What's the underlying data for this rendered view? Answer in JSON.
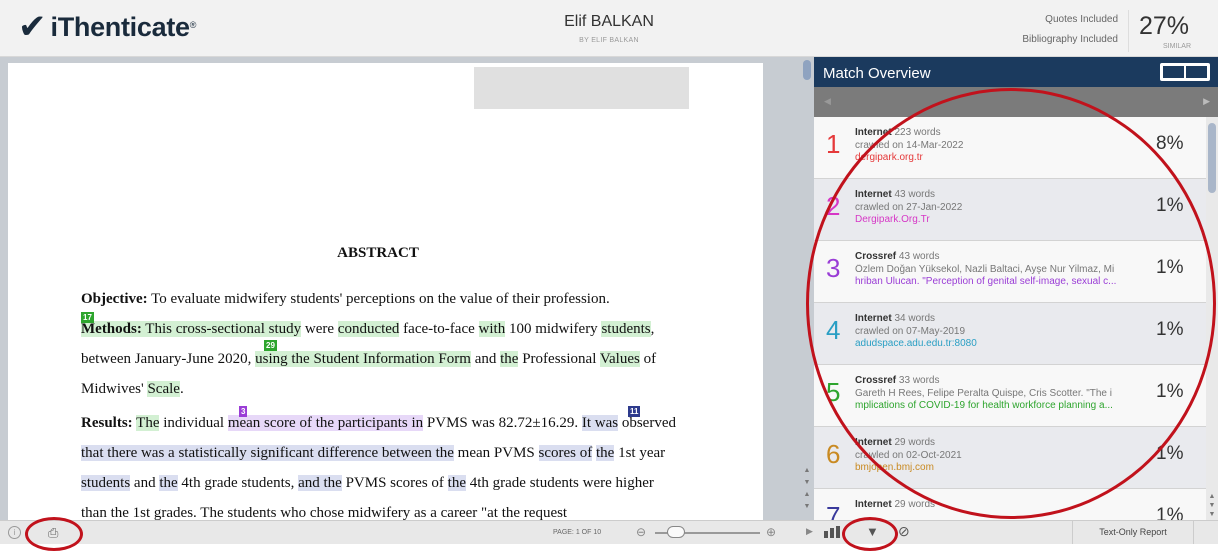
{
  "header": {
    "brand": "iThenticate",
    "check": "✔",
    "reg": "®",
    "doc_title": "Elif BALKAN",
    "doc_author": "BY ELIF BALKAN",
    "filter_quotes": "Quotes Included",
    "filter_bibliography": "Bibliography Included",
    "similarity": "27%",
    "similarity_label": "SIMILAR"
  },
  "document": {
    "heading": "ABSTRACT",
    "objective_label": "Objective:",
    "objective_text": " To evaluate midwifery students' perceptions on the value of their profession.",
    "tag17": "17",
    "tag29": "29",
    "tag3": "3",
    "tag11": "11",
    "m_label": "Methods:",
    "m1": " This cross-sectional study",
    "m2": " were ",
    "m3": "conducted",
    "m4": " face-to-face ",
    "m5": "with",
    "m6": " 100 midwifery ",
    "m7": "students",
    "m8": ", between January-June 2020, ",
    "m9": "using the Student Information Form",
    "m10": " and ",
    "m11": "the",
    "m12": " Professional ",
    "m13": "Values",
    "m14": " of Midwives' ",
    "m15": "Scale",
    "m16": ".",
    "r_label": "Results:",
    "r1": " ",
    "r2": "The",
    "r3": " individual ",
    "r4": "mean score of the participants in",
    "r5": " PVMS was 82.72±16.29. ",
    "r6": "It was",
    "r7": " observed ",
    "r8": "that there was a statistically significant difference between the",
    "r9": " mean PVMS ",
    "r10": "scores of",
    "r11": " ",
    "r12": "the",
    "r13": " 1st year ",
    "r14": "students",
    "r15": " and ",
    "r16": "the",
    "r17": " 4th grade students, ",
    "r18": "and the",
    "r19": " PVMS scores of ",
    "r20": "the",
    "r21": " 4th grade students were higher than the 1st grades. The students who chose midwifery as a career \"at the request"
  },
  "bottom_bar": {
    "info_icon": "i",
    "print_icon": "⎙",
    "page_label": "PAGE: 1 OF 10",
    "zoom_out": "⊖",
    "zoom_in": "⊕",
    "arrow": "▶",
    "filter_icon": "▼",
    "block_icon": "⊘",
    "text_only": "Text-Only Report"
  },
  "panel": {
    "title": "Match Overview",
    "left_arrow": "◀",
    "right_arrow": "▶",
    "matches": [
      {
        "num": "1",
        "type": "Internet",
        "words": "223 words",
        "crawled": "crawled on 14-Mar-2022",
        "link": "dergipark.org.tr",
        "pct": "8%",
        "color": "#e5393a"
      },
      {
        "num": "2",
        "type": "Internet",
        "words": "43 words",
        "crawled": "crawled on 27-Jan-2022",
        "link": "Dergipark.Org.Tr",
        "pct": "1%",
        "color": "#d637c6"
      },
      {
        "num": "3",
        "type": "Crossref",
        "words": "43 words",
        "crawled": "Özlem Doğan Yüksekol, Nazli Baltaci, Ayşe Nur Yilmaz, Mi",
        "link": "hriban Ulucan. \"Perception of genital self-image, sexual c...",
        "pct": "1%",
        "color": "#9a3dd6"
      },
      {
        "num": "4",
        "type": "Internet",
        "words": "34 words",
        "crawled": "crawled on 07-May-2019",
        "link": "adudspace.adu.edu.tr:8080",
        "pct": "1%",
        "color": "#2a9fc4"
      },
      {
        "num": "5",
        "type": "Crossref",
        "words": "33 words",
        "crawled": "Gareth H Rees, Felipe Peralta Quispe, Cris Scotter. \"The i",
        "link": "mplications of COVID-19 for health workforce planning a...",
        "pct": "1%",
        "color": "#2ea52e"
      },
      {
        "num": "6",
        "type": "Internet",
        "words": "29 words",
        "crawled": "crawled on 02-Oct-2021",
        "link": "bmjopen.bmj.com",
        "pct": "1%",
        "color": "#c98a22"
      },
      {
        "num": "7",
        "type": "Internet",
        "words": "29 words",
        "crawled": "",
        "link": "",
        "pct": "1%",
        "color": "#3a3a9c"
      }
    ]
  },
  "colors": {
    "header_bg": "#f2f2f2",
    "panel_head": "#1b3a5e",
    "annotation": "#c1121c"
  }
}
